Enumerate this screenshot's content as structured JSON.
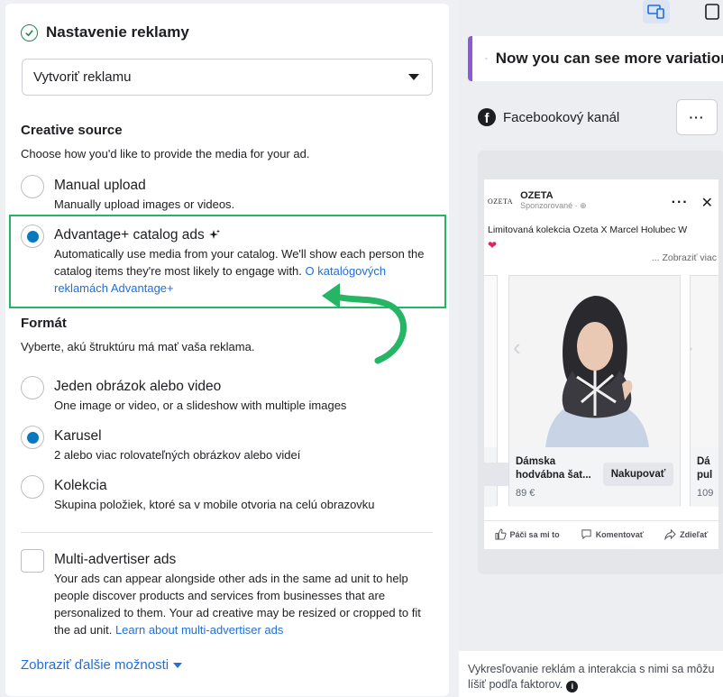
{
  "section": {
    "title": "Nastavenie reklamy"
  },
  "ad_select": {
    "value": "Vytvoriť reklamu"
  },
  "creative_source": {
    "heading": "Creative source",
    "subtitle": "Choose how you'd like to provide the media for your ad.",
    "options": [
      {
        "title": "Manual upload",
        "desc": "Manually upload images or videos.",
        "selected": false
      },
      {
        "title": "Advantage+ catalog ads",
        "desc": "Automatically use media from your catalog. We'll show each person the catalog items they're most likely to engage with.",
        "link": "O katalógových reklamách Advantage+",
        "selected": true
      }
    ]
  },
  "format": {
    "heading": "Formát",
    "subtitle": "Vyberte, akú štruktúru má mať vaša reklama.",
    "options": [
      {
        "title": "Jeden obrázok alebo video",
        "desc": "One image or video, or a slideshow with multiple images",
        "selected": false
      },
      {
        "title": "Karusel",
        "desc": "2 alebo viac rolovateľných obrázkov alebo videí",
        "selected": true
      },
      {
        "title": "Kolekcia",
        "desc": "Skupina položiek, ktoré sa v mobile otvoria na celú obrazovku",
        "selected": false
      }
    ]
  },
  "multi_advertiser": {
    "title": "Multi-advertiser ads",
    "desc": "Your ads can appear alongside other ads in the same ad unit to help people discover products and services from businesses that are personalized to them. Your ad creative may be resized or cropped to fit the ad unit.",
    "link": "Learn about multi-advertiser ads"
  },
  "show_more": "Zobraziť ďalšie možnosti",
  "preview": {
    "banner": "Now you can see more variations",
    "placement": "Facebookový kanál",
    "more_label": "···",
    "post": {
      "brand_logo": "OZETA",
      "brand_name": "OZETA",
      "sponsored": "Sponzorované · ⊕",
      "caption": "Limitovaná kolekcia Ozeta X Marcel Holubec W",
      "see_more": "... Zobraziť viac",
      "cards": [
        {
          "name": "Dámska hodvábna šat...",
          "price": "89 €",
          "cta": "Nakupovať"
        },
        {
          "name": "Dá pul",
          "price": "109"
        }
      ],
      "reactions": [
        "Páči sa mi to",
        "Komentovať",
        "Zdieľať"
      ]
    },
    "footer": "Vykresľovanie reklám a interakcia s nimi sa môžu líšiť podľa faktorov."
  },
  "colors": {
    "accent_green": "#25b565",
    "link_blue": "#216fdb",
    "radio_blue": "#0a78be",
    "banner_purple": "#8a5ad9"
  }
}
